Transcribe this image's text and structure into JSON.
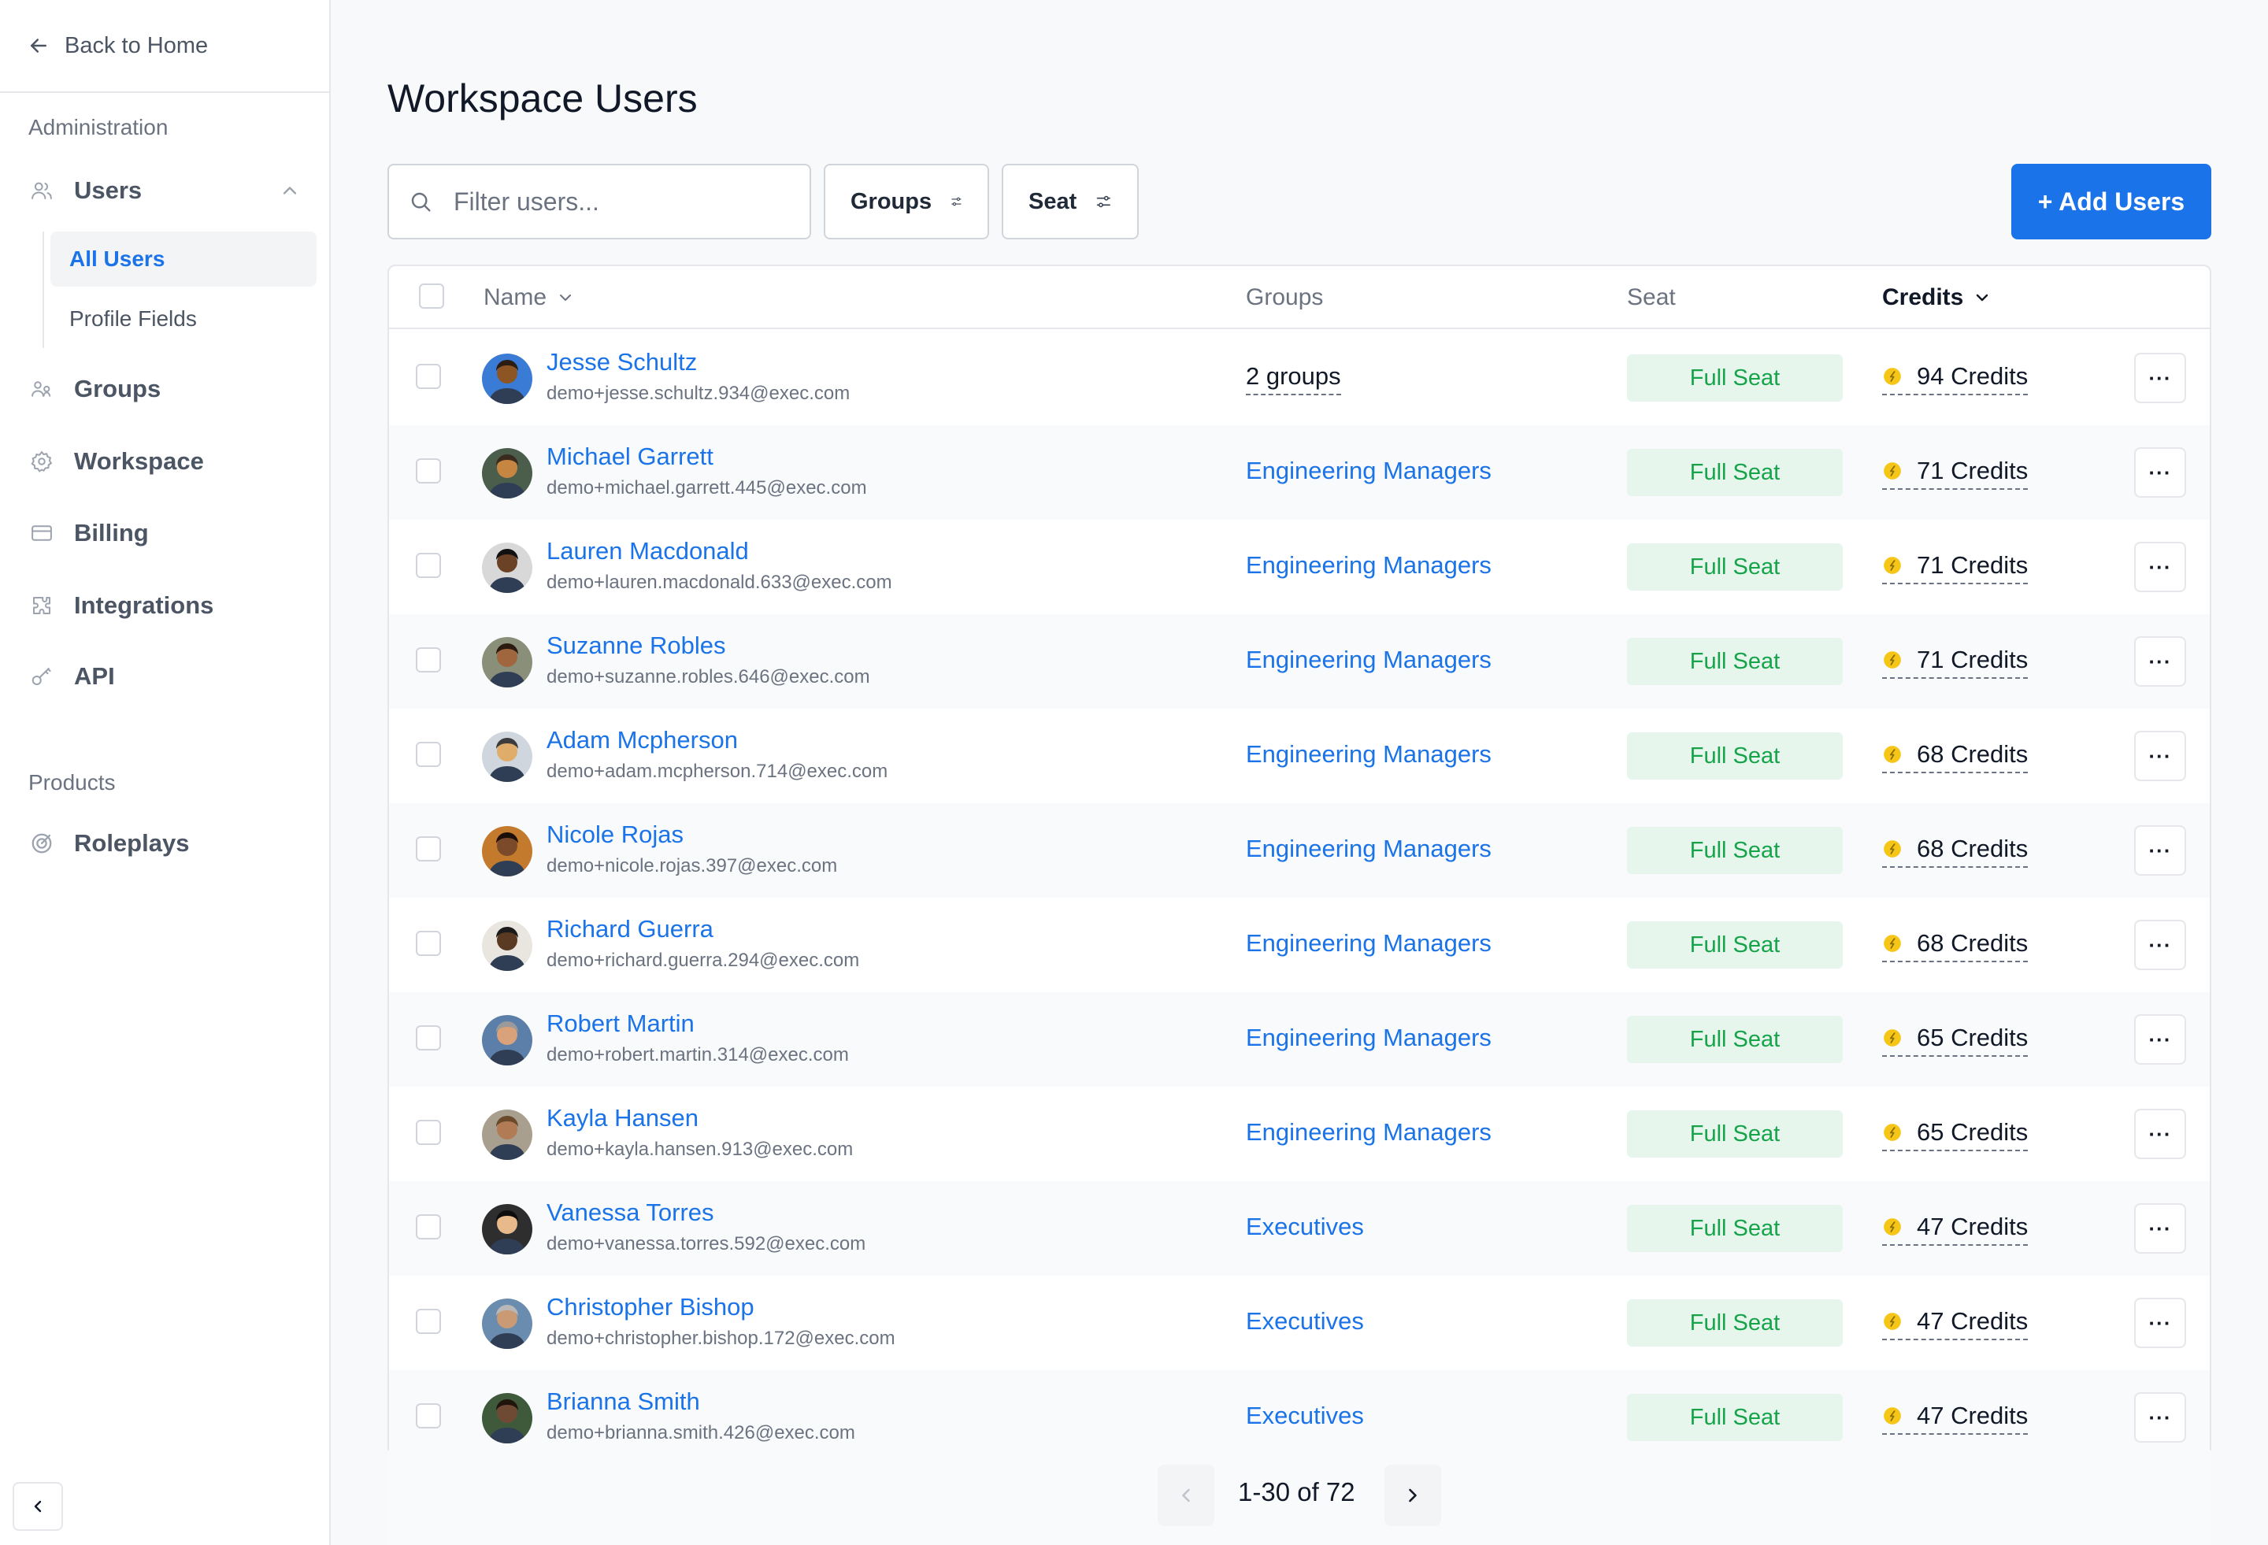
{
  "sidebar": {
    "back_label": "Back to Home",
    "section_admin": "Administration",
    "users_label": "Users",
    "all_users_label": "All Users",
    "profile_fields_label": "Profile Fields",
    "groups_label": "Groups",
    "workspace_label": "Workspace",
    "billing_label": "Billing",
    "integrations_label": "Integrations",
    "api_label": "API",
    "section_products": "Products",
    "roleplays_label": "Roleplays"
  },
  "page": {
    "title": "Workspace Users"
  },
  "toolbar": {
    "search_placeholder": "Filter users...",
    "groups_filter": "Groups",
    "seat_filter": "Seat",
    "add_users": "+ Add Users"
  },
  "table": {
    "headers": {
      "name": "Name",
      "groups": "Groups",
      "seat": "Seat",
      "credits": "Credits"
    },
    "rows": [
      {
        "name": "Jesse Schultz",
        "email": "demo+jesse.schultz.934@exec.com",
        "groups": "2 groups",
        "groups_is_count": true,
        "seat": "Full Seat",
        "credits": "94 Credits",
        "more": "···"
      },
      {
        "name": "Michael Garrett",
        "email": "demo+michael.garrett.445@exec.com",
        "groups": "Engineering Managers",
        "groups_is_count": false,
        "seat": "Full Seat",
        "credits": "71 Credits",
        "more": "···"
      },
      {
        "name": "Lauren Macdonald",
        "email": "demo+lauren.macdonald.633@exec.com",
        "groups": "Engineering Managers",
        "groups_is_count": false,
        "seat": "Full Seat",
        "credits": "71 Credits",
        "more": "···"
      },
      {
        "name": "Suzanne Robles",
        "email": "demo+suzanne.robles.646@exec.com",
        "groups": "Engineering Managers",
        "groups_is_count": false,
        "seat": "Full Seat",
        "credits": "71 Credits",
        "more": "···"
      },
      {
        "name": "Adam Mcpherson",
        "email": "demo+adam.mcpherson.714@exec.com",
        "groups": "Engineering Managers",
        "groups_is_count": false,
        "seat": "Full Seat",
        "credits": "68 Credits",
        "more": "···"
      },
      {
        "name": "Nicole Rojas",
        "email": "demo+nicole.rojas.397@exec.com",
        "groups": "Engineering Managers",
        "groups_is_count": false,
        "seat": "Full Seat",
        "credits": "68 Credits",
        "more": "···"
      },
      {
        "name": "Richard Guerra",
        "email": "demo+richard.guerra.294@exec.com",
        "groups": "Engineering Managers",
        "groups_is_count": false,
        "seat": "Full Seat",
        "credits": "68 Credits",
        "more": "···"
      },
      {
        "name": "Robert Martin",
        "email": "demo+robert.martin.314@exec.com",
        "groups": "Engineering Managers",
        "groups_is_count": false,
        "seat": "Full Seat",
        "credits": "65 Credits",
        "more": "···"
      },
      {
        "name": "Kayla Hansen",
        "email": "demo+kayla.hansen.913@exec.com",
        "groups": "Engineering Managers",
        "groups_is_count": false,
        "seat": "Full Seat",
        "credits": "65 Credits",
        "more": "···"
      },
      {
        "name": "Vanessa Torres",
        "email": "demo+vanessa.torres.592@exec.com",
        "groups": "Executives",
        "groups_is_count": false,
        "seat": "Full Seat",
        "credits": "47 Credits",
        "more": "···"
      },
      {
        "name": "Christopher Bishop",
        "email": "demo+christopher.bishop.172@exec.com",
        "groups": "Executives",
        "groups_is_count": false,
        "seat": "Full Seat",
        "credits": "47 Credits",
        "more": "···"
      },
      {
        "name": "Brianna Smith",
        "email": "demo+brianna.smith.426@exec.com",
        "groups": "Executives",
        "groups_is_count": false,
        "seat": "Full Seat",
        "credits": "47 Credits",
        "more": "···"
      }
    ]
  },
  "pagination": {
    "label": "1-30 of 72"
  },
  "colors": {
    "accent": "#1a73e8",
    "seat_bg": "#e6f6ec",
    "seat_text": "#16a34a",
    "credit_coin": "#f5c518"
  },
  "icons": {
    "back": "arrow-left-icon",
    "users": "users-icon",
    "groups": "groups-icon",
    "workspace": "gear-icon",
    "billing": "credit-card-icon",
    "integrations": "puzzle-icon",
    "api": "key-icon",
    "roleplays": "target-icon",
    "search": "search-icon",
    "filter": "sliders-icon",
    "credits": "coin-icon"
  }
}
